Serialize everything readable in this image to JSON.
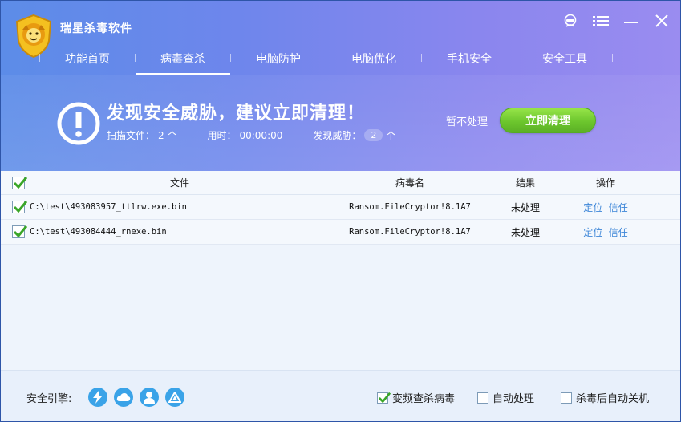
{
  "app": {
    "title": "瑞星杀毒软件"
  },
  "nav": {
    "tabs": [
      {
        "label": "功能首页"
      },
      {
        "label": "病毒查杀"
      },
      {
        "label": "电脑防护"
      },
      {
        "label": "电脑优化"
      },
      {
        "label": "手机安全"
      },
      {
        "label": "安全工具"
      }
    ],
    "active_index": 1
  },
  "alert": {
    "title": "发现安全威胁，建议立即清理！",
    "scan_files_label": "扫描文件：",
    "scan_files_value": "2 个",
    "time_label": "用时：",
    "time_value": "00:00:00",
    "threats_label": "发现威胁：",
    "threats_value": "2",
    "threats_unit": "个",
    "skip_label": "暂不处理",
    "clean_label": "立即清理"
  },
  "table": {
    "headers": {
      "file": "文件",
      "virus": "病毒名",
      "result": "结果",
      "action": "操作"
    },
    "rows": [
      {
        "file": "C:\\test\\493083957_ttlrw.exe.bin",
        "virus": "Ransom.FileCryptor!8.1A7",
        "result": "未处理",
        "locate": "定位",
        "trust": "信任"
      },
      {
        "file": "C:\\test\\493084444_rnexe.bin",
        "virus": "Ransom.FileCryptor!8.1A7",
        "result": "未处理",
        "locate": "定位",
        "trust": "信任"
      }
    ]
  },
  "footer": {
    "engine_label": "安全引擎:",
    "engines": [
      "lightning-icon",
      "cloud-icon",
      "user-icon",
      "triangle-icon"
    ],
    "options": {
      "freq_scan": {
        "label": "变频查杀病毒",
        "checked": true
      },
      "auto_handle": {
        "label": "自动处理",
        "checked": false
      },
      "auto_shutdown": {
        "label": "杀毒后自动关机",
        "checked": false
      }
    }
  },
  "colors": {
    "accent_green": "#5fc11a",
    "link_blue": "#3d86d8",
    "engine_blue": "#3aa3e8"
  }
}
